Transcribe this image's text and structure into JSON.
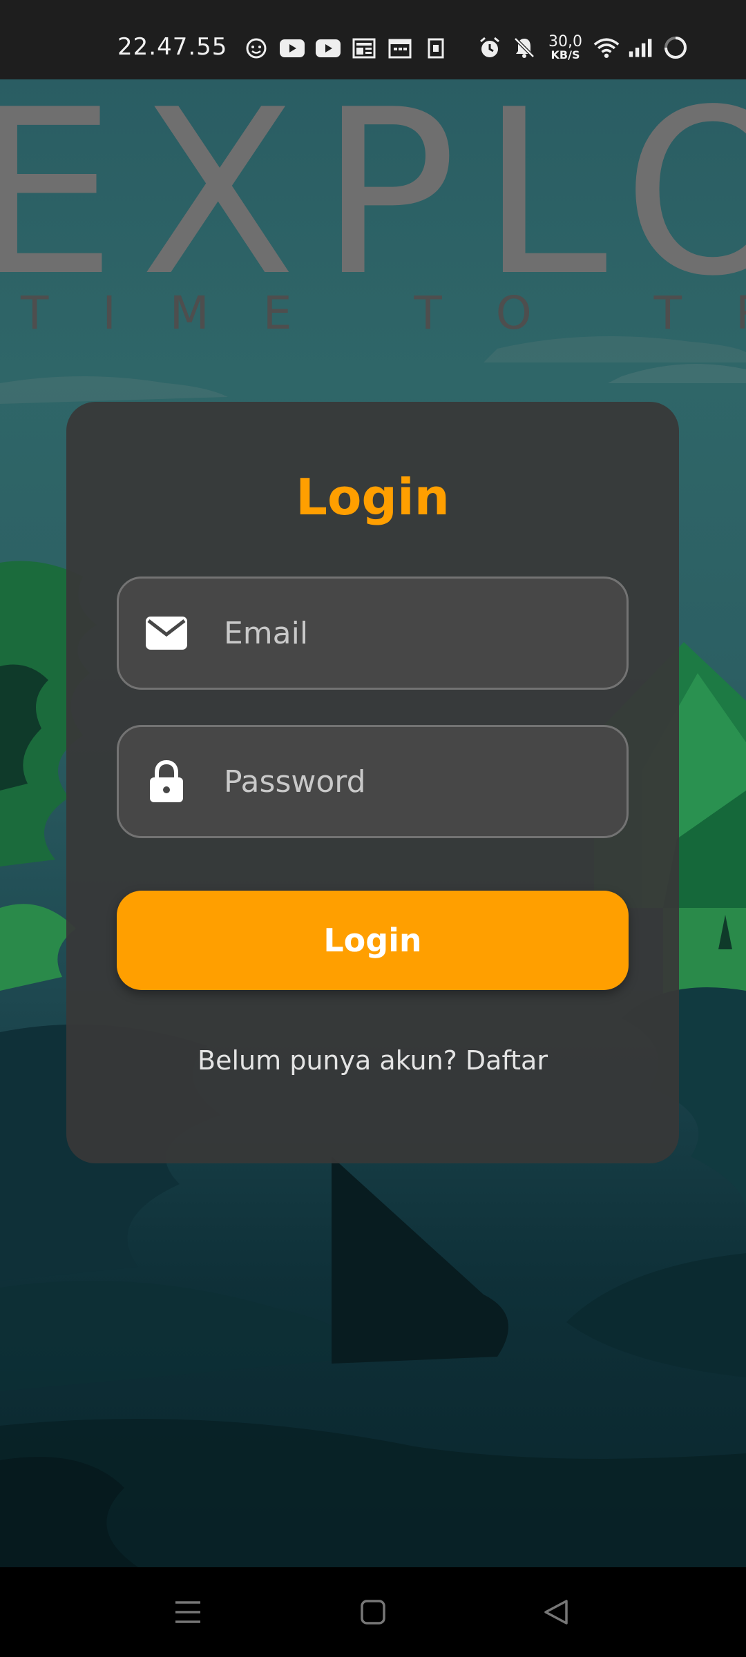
{
  "status_bar": {
    "time": "22.47.55",
    "left_icons": [
      "face-icon",
      "youtube-icon",
      "youtube-icon",
      "news-icon",
      "calendar-icon",
      "sim-icon"
    ],
    "net_speed_value": "30,0",
    "net_speed_unit": "KB/S",
    "right_icons": [
      "alarm-icon",
      "bell-off-icon",
      "wifi-icon",
      "signal-icon",
      "battery-ring-icon"
    ]
  },
  "background": {
    "headline": "EXPLORE",
    "tagline": "TIME TO TRAVEL"
  },
  "login_card": {
    "title": "Login",
    "email": {
      "placeholder": "Email",
      "value": "",
      "icon": "mail-icon"
    },
    "password": {
      "placeholder": "Password",
      "value": "",
      "icon": "lock-icon"
    },
    "submit_label": "Login",
    "register_prompt": "Belum punya akun? Daftar"
  },
  "colors": {
    "accent": "#ff9f00",
    "card": "#383838",
    "field": "#474747",
    "status_bar": "#1e1e1e",
    "nav_bar": "#000000"
  },
  "nav_bar": {
    "buttons": [
      "menu-icon",
      "home-icon",
      "back-icon"
    ]
  }
}
